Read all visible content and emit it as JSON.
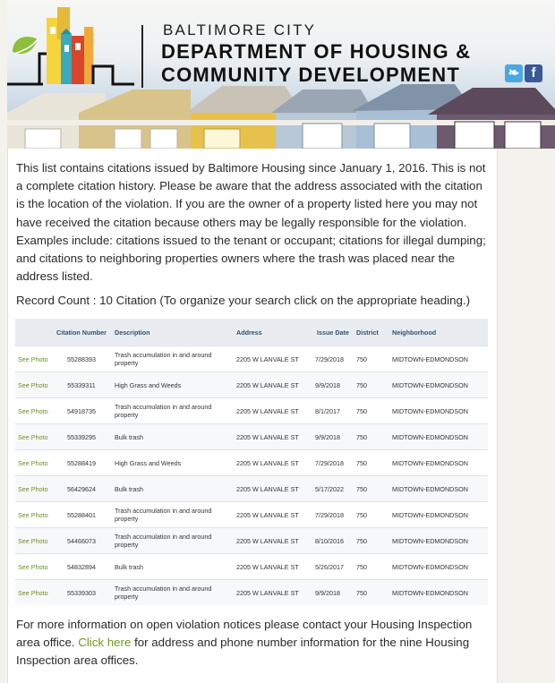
{
  "header": {
    "line1": "BALTIMORE CITY",
    "line2": "DEPARTMENT OF HOUSING &",
    "line3": "COMMUNITY DEVELOPMENT",
    "twitter_icon": "twitter-icon",
    "facebook_icon": "facebook-icon",
    "colors": {
      "logo_leaf": "#8dbf3c",
      "logo_red": "#d9452b",
      "logo_orange": "#f2a93b",
      "logo_teal": "#3aa9b8",
      "logo_yellow": "#f5d43e"
    }
  },
  "intro": "This list contains citations issued by Baltimore Housing since January 1, 2016. This is not a complete citation history. Please be aware that the address associated with the citation is the location of the violation. If you are the owner of a property listed here you may not have received the citation because others may be legally responsible for the violation. Examples include: citations issued to the tenant or occupant; citations for illegal dumping; and citations to neighboring properties owners where the trash was placed near the address listed.",
  "record_count": "Record Count : 10 Citation (To organize your search click on the appropriate heading.)",
  "table": {
    "headers": [
      "",
      "Citation Number",
      "Description",
      "Address",
      "Issue Date",
      "District",
      "Neighborhood"
    ],
    "rows": [
      {
        "photo": "See Photo",
        "number": "55288393",
        "description": "Trash accumulation in and around property",
        "address": "2205 W LANVALE ST",
        "date": "7/29/2018",
        "district": "750",
        "neighborhood": "MIDTOWN-EDMONDSON"
      },
      {
        "photo": "See Photo",
        "number": "55339311",
        "description": "High Grass and Weeds",
        "address": "2205 W LANVALE ST",
        "date": "9/9/2018",
        "district": "750",
        "neighborhood": "MIDTOWN-EDMONDSON"
      },
      {
        "photo": "See Photo",
        "number": "54918735",
        "description": "Trash accumulation in and around property",
        "address": "2205 W LANVALE ST",
        "date": "8/1/2017",
        "district": "750",
        "neighborhood": "MIDTOWN-EDMONDSON"
      },
      {
        "photo": "See Photo",
        "number": "55339295",
        "description": "Bulk trash",
        "address": "2205 W LANVALE ST",
        "date": "9/9/2018",
        "district": "750",
        "neighborhood": "MIDTOWN-EDMONDSON"
      },
      {
        "photo": "See Photo",
        "number": "55288419",
        "description": "High Grass and Weeds",
        "address": "2205 W LANVALE ST",
        "date": "7/29/2018",
        "district": "750",
        "neighborhood": "MIDTOWN-EDMONDSON"
      },
      {
        "photo": "See Photo",
        "number": "56429624",
        "description": "Bulk trash",
        "address": "2205 W LANVALE ST",
        "date": "5/17/2022",
        "district": "750",
        "neighborhood": "MIDTOWN-EDMONDSON"
      },
      {
        "photo": "See Photo",
        "number": "55288401",
        "description": "Trash accumulation in and around property",
        "address": "2205 W LANVALE ST",
        "date": "7/29/2018",
        "district": "750",
        "neighborhood": "MIDTOWN-EDMONDSON"
      },
      {
        "photo": "See Photo",
        "number": "54466073",
        "description": "Trash accumulation in and around property",
        "address": "2205 W LANVALE ST",
        "date": "8/10/2016",
        "district": "750",
        "neighborhood": "MIDTOWN-EDMONDSON"
      },
      {
        "photo": "See Photo",
        "number": "54832894",
        "description": "Bulk trash",
        "address": "2205 W LANVALE ST",
        "date": "5/26/2017",
        "district": "750",
        "neighborhood": "MIDTOWN-EDMONDSON"
      },
      {
        "photo": "See Photo",
        "number": "55339303",
        "description": "Trash accumulation in and around property",
        "address": "2205 W LANVALE ST",
        "date": "9/9/2018",
        "district": "750",
        "neighborhood": "MIDTOWN-EDMONDSON"
      }
    ]
  },
  "footer": {
    "text_before": "For more information on open violation notices please contact your Housing Inspection area office. ",
    "link": "Click here",
    "text_after": " for address and phone number information for the nine Housing Inspection area offices."
  }
}
